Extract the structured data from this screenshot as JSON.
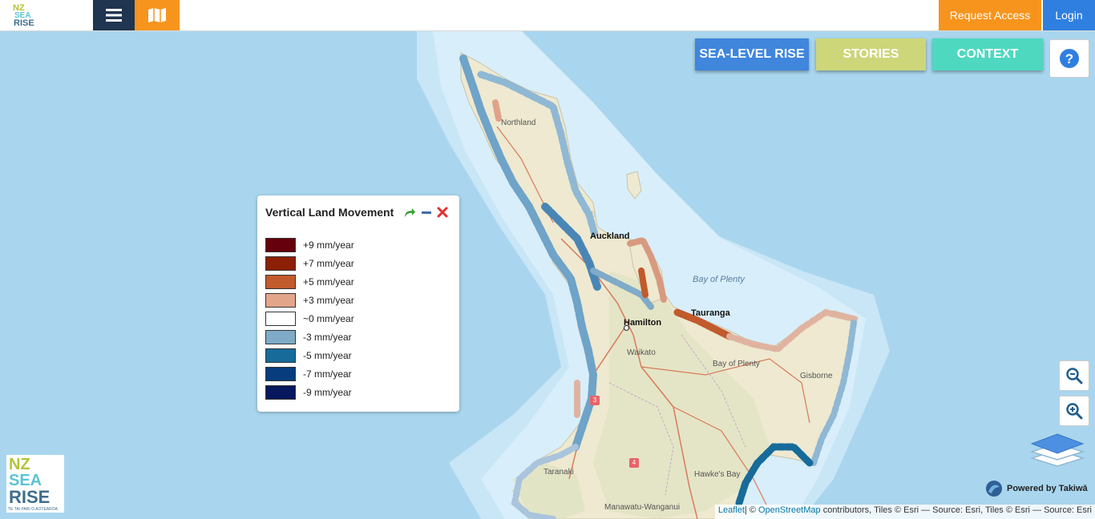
{
  "header": {
    "request_access": "Request Access",
    "login": "Login",
    "menu_icon": "hamburger-icon",
    "map_icon": "map-icon"
  },
  "nav": {
    "sea_level_rise": "SEA-LEVEL RISE",
    "stories": "STORIES",
    "context": "CONTEXT",
    "help_icon": "question-circle-icon"
  },
  "legend": {
    "title": "Vertical Land Movement",
    "items": [
      {
        "label": "+9 mm/year",
        "color": "#67000d"
      },
      {
        "label": "+7 mm/year",
        "color": "#8c2006"
      },
      {
        "label": "+5 mm/year",
        "color": "#c15a2c"
      },
      {
        "label": "+3 mm/year",
        "color": "#e3a58a"
      },
      {
        "label": "~0 mm/year",
        "color": "#ffffff"
      },
      {
        "label": "-3 mm/year",
        "color": "#7fabc8"
      },
      {
        "label": "-5 mm/year",
        "color": "#176b9b"
      },
      {
        "label": "-7 mm/year",
        "color": "#073c7d"
      },
      {
        "label": "-9 mm/year",
        "color": "#08185e"
      }
    ]
  },
  "map": {
    "places": {
      "northland": "Northland",
      "auckland": "Auckland",
      "hamilton": "Hamilton",
      "waikato": "Waikato",
      "tauranga": "Tauranga",
      "bay_of_plenty_sea": "Bay of Plenty",
      "bay_of_plenty_region": "Bay of Plenty",
      "gisborne": "Gisborne",
      "taranaki": "Taranaki",
      "hawkes_bay": "Hawke's Bay",
      "manawatu": "Manawatu-Wanganui"
    },
    "road_3": "3",
    "road_4": "4"
  },
  "brand": {
    "logo_line1": "NZ",
    "logo_line2": "SEA",
    "logo_line3": "RISE",
    "logo_tagline": "TE TAI PARI O AOTEAROA",
    "powered_by": "Powered by Takiwā"
  },
  "attribution": {
    "leaflet": "Leaflet",
    "osm_prefix": "| © ",
    "osm": "OpenStreetMap",
    "rest": " contributors, Tiles © Esri — Source: Esri, Tiles © Esri — Source: Esri"
  }
}
